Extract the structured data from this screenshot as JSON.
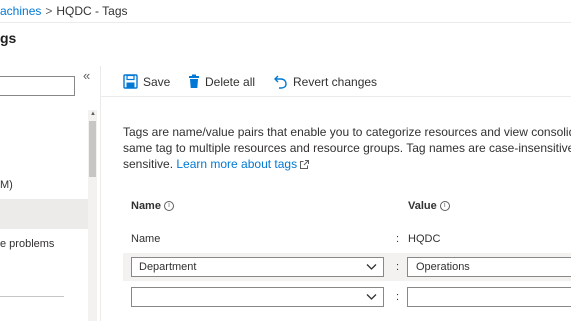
{
  "breadcrumb": {
    "link_text": "achines",
    "separator": ">",
    "current": "HQDC - Tags"
  },
  "page": {
    "title": "gs"
  },
  "left_nav": {
    "collapse_glyph": "«",
    "items": [
      {
        "label": "M)"
      },
      {
        "label": "e problems"
      }
    ]
  },
  "toolbar": {
    "save_label": "Save",
    "delete_all_label": "Delete all",
    "revert_label": "Revert changes"
  },
  "description": {
    "line1": "Tags are name/value pairs that enable you to categorize resources and view consolid",
    "line2": "same tag to multiple resources and resource groups. Tag names are case-insensitive",
    "line3_prefix": "sensitive. ",
    "learn_more": "Learn more about tags"
  },
  "table": {
    "name_header": "Name",
    "value_header": "Value",
    "info_glyph": "i",
    "colon": ":",
    "rows": [
      {
        "name": "Name",
        "value": "HQDC"
      },
      {
        "name": "Department",
        "value": "Operations"
      },
      {
        "name": "",
        "value": ""
      }
    ]
  },
  "colors": {
    "accent": "#0078d4",
    "highlight": "#f3f2f1",
    "text": "#323130"
  }
}
